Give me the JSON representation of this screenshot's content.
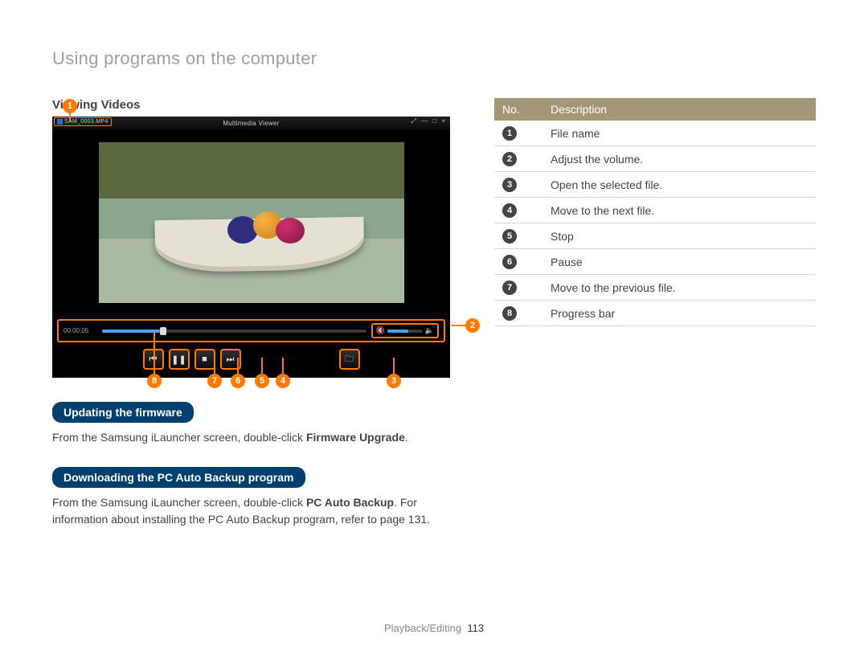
{
  "heading": "Using programs on the computer",
  "sectionVideos": "Viewing Videos",
  "player": {
    "title": "Multimedia Viewer",
    "fileTab": "SAM_0003.MP4",
    "winControls": "⤢ — □ ×",
    "time": "00:00:05",
    "volIcon": "🔈",
    "volMuteIcon": "🔇",
    "buttons": {
      "prev": "⏮",
      "pause": "❚❚",
      "stop": "■",
      "next": "⏭",
      "open": "🗀"
    }
  },
  "callouts": {
    "c1": "1",
    "c2": "2",
    "c3": "3",
    "c4": "4",
    "c5": "5",
    "c6": "6",
    "c7": "7",
    "c8": "8"
  },
  "pill1": "Updating the firmware",
  "para1_a": "From the Samsung iLauncher screen, double-click ",
  "para1_b": "Firmware Upgrade",
  "para1_c": ".",
  "pill2": "Downloading the PC Auto Backup program",
  "para2_a": "From the Samsung iLauncher screen, double-click ",
  "para2_b": "PC Auto Backup",
  "para2_c": ". For information about installing the PC Auto Backup program, refer to page 131.",
  "table": {
    "h1": "No.",
    "h2": "Description",
    "rows": [
      {
        "n": "1",
        "d": "File name"
      },
      {
        "n": "2",
        "d": "Adjust the volume."
      },
      {
        "n": "3",
        "d": "Open the selected file."
      },
      {
        "n": "4",
        "d": "Move to the next file."
      },
      {
        "n": "5",
        "d": "Stop"
      },
      {
        "n": "6",
        "d": "Pause"
      },
      {
        "n": "7",
        "d": "Move to the previous file."
      },
      {
        "n": "8",
        "d": "Progress bar"
      }
    ]
  },
  "footer": {
    "section": "Playback/Editing",
    "page": "113"
  }
}
